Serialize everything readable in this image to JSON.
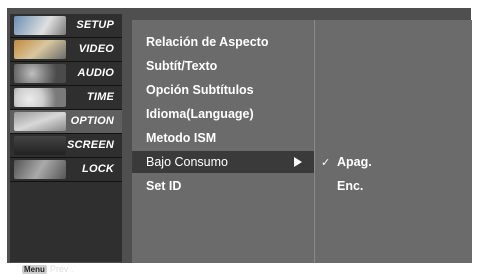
{
  "left_menu": {
    "items": [
      {
        "label": "SETUP",
        "icon": "setup-icon"
      },
      {
        "label": "VIDEO",
        "icon": "video-icon"
      },
      {
        "label": "AUDIO",
        "icon": "audio-icon"
      },
      {
        "label": "TIME",
        "icon": "time-icon"
      },
      {
        "label": "OPTION",
        "icon": "option-icon"
      },
      {
        "label": "SCREEN",
        "icon": "screen-icon"
      },
      {
        "label": "LOCK",
        "icon": "lock-icon"
      }
    ],
    "active_index": 4,
    "footer": {
      "key": "Menu",
      "label": "Prev ."
    }
  },
  "submenu": {
    "items": [
      "Relación de Aspecto",
      "Subtít/Texto",
      "Opción Subtítulos",
      "Idioma(Language)",
      "Metodo ISM",
      "Bajo Consumo",
      "Set ID"
    ],
    "selected_index": 5
  },
  "values": {
    "items": [
      "Apag.",
      "Enc."
    ],
    "checked_index": 0,
    "check_mark": "✓"
  },
  "colors": {
    "background": "#4f4f4f",
    "submenu": "#6b6b6b",
    "selection": "#3a3a3a",
    "text": "#ffffff"
  }
}
